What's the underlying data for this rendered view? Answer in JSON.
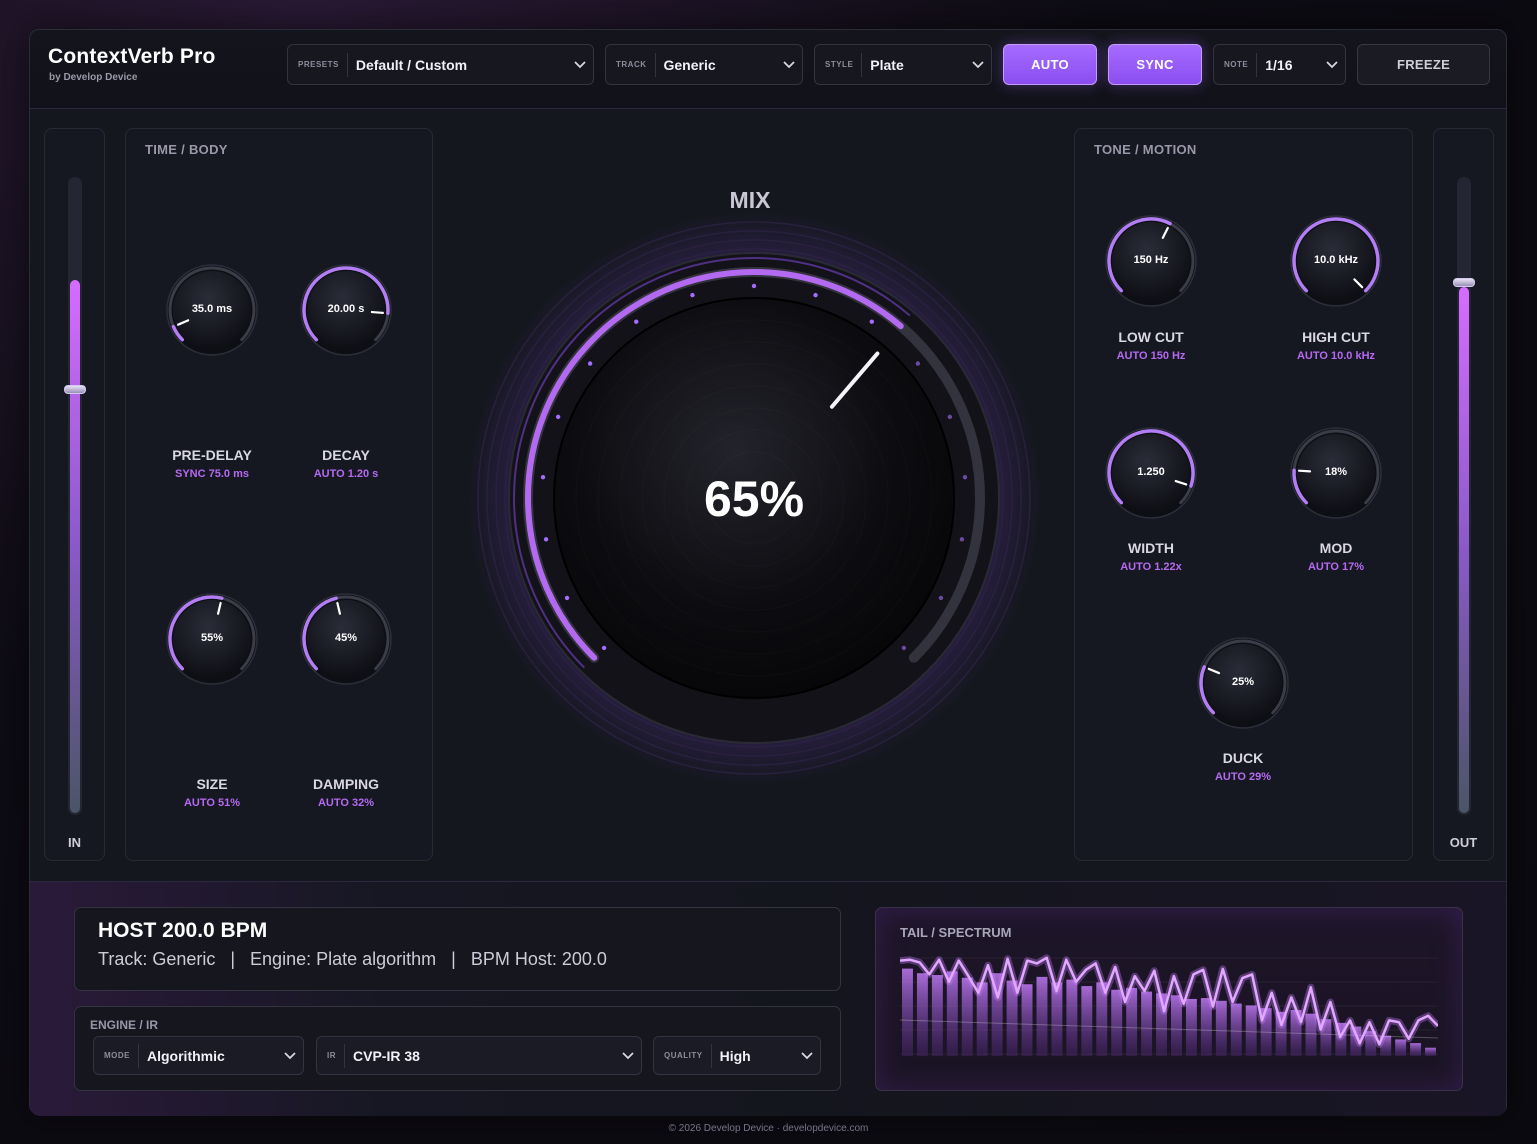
{
  "header": {
    "title": "ContextVerb Pro",
    "subtitle": "by Develop Device",
    "presets": {
      "tag": "PRESETS",
      "value": "Default / Custom"
    },
    "track": {
      "tag": "TRACK",
      "value": "Generic"
    },
    "style": {
      "tag": "STYLE",
      "value": "Plate"
    },
    "auto_label": "AUTO",
    "sync_label": "SYNC",
    "note": {
      "tag": "NOTE",
      "value": "1/16"
    },
    "freeze_label": "FREEZE"
  },
  "meters": {
    "in": {
      "label": "IN",
      "level": 0.84,
      "handle": 0.67
    },
    "out": {
      "label": "OUT",
      "level": 0.83,
      "handle": 0.84
    }
  },
  "time_body": {
    "title": "TIME / BODY",
    "knobs": [
      {
        "value": "35.0 ms",
        "label": "PRE-DELAY",
        "sub": "SYNC 75.0 ms",
        "pos": 0.08
      },
      {
        "value": "20.00 s",
        "label": "DECAY",
        "sub": "AUTO 1.20 s",
        "pos": 0.85
      },
      {
        "value": "55%",
        "label": "SIZE",
        "sub": "AUTO 51%",
        "pos": 0.55
      },
      {
        "value": "45%",
        "label": "DAMPING",
        "sub": "AUTO 32%",
        "pos": 0.45
      }
    ]
  },
  "mix": {
    "title": "MIX",
    "value": "65%",
    "fraction": 0.65
  },
  "tone_motion": {
    "title": "TONE / MOTION",
    "knobs": [
      {
        "value": "150 Hz",
        "label": "LOW CUT",
        "sub": "AUTO 150 Hz",
        "pos": 0.6
      },
      {
        "value": "10.0 kHz",
        "label": "HIGH CUT",
        "sub": "AUTO 10.0 kHz",
        "pos": 1.0
      },
      {
        "value": "1.250",
        "label": "WIDTH",
        "sub": "AUTO 1.22x",
        "pos": 0.9
      },
      {
        "value": "18%",
        "label": "MOD",
        "sub": "AUTO 17%",
        "pos": 0.18
      },
      {
        "value": "25%",
        "label": "DUCK",
        "sub": "AUTO 29%",
        "pos": 0.25
      }
    ]
  },
  "host": {
    "title": "HOST 200.0 BPM",
    "info": "Track: Generic   |   Engine: Plate algorithm   |   BPM Host: 200.0"
  },
  "engine": {
    "title": "ENGINE / IR",
    "mode": {
      "tag": "MODE",
      "value": "Algorithmic"
    },
    "ir": {
      "tag": "IR",
      "value": "CVP-IR 38"
    },
    "quality": {
      "tag": "QUALITY",
      "value": "High"
    }
  },
  "spectrum": {
    "title": "TAIL / SPECTRUM",
    "bars": [
      0.95,
      0.9,
      0.88,
      0.92,
      0.85,
      0.8,
      0.9,
      0.82,
      0.78,
      0.86,
      0.8,
      0.83,
      0.76,
      0.8,
      0.72,
      0.74,
      0.7,
      0.68,
      0.66,
      0.62,
      0.63,
      0.6,
      0.57,
      0.55,
      0.52,
      0.48,
      0.5,
      0.46,
      0.4,
      0.36,
      0.32,
      0.27,
      0.22,
      0.18,
      0.14,
      0.09
    ],
    "curve": [
      0.95,
      0.96,
      0.93,
      0.8,
      0.96,
      0.72,
      0.95,
      0.78,
      0.6,
      0.9,
      0.55,
      0.97,
      0.6,
      0.95,
      0.92,
      0.98,
      0.62,
      0.96,
      0.72,
      0.85,
      0.92,
      0.6,
      0.88,
      0.5,
      0.78,
      0.62,
      0.84,
      0.4,
      0.78,
      0.48,
      0.8,
      0.85,
      0.45,
      0.86,
      0.5,
      0.76,
      0.8,
      0.3,
      0.6,
      0.25,
      0.55,
      0.28,
      0.66,
      0.2,
      0.5,
      0.12,
      0.3,
      0.05,
      0.28,
      0.04,
      0.3,
      0.28,
      0.1,
      0.3,
      0.35,
      0.24
    ]
  },
  "footer": "© 2026 Develop Device · developdevice.com",
  "colors": {
    "accent": "#a56cff",
    "accent_text": "#b46af0",
    "bg": "#15171f"
  }
}
